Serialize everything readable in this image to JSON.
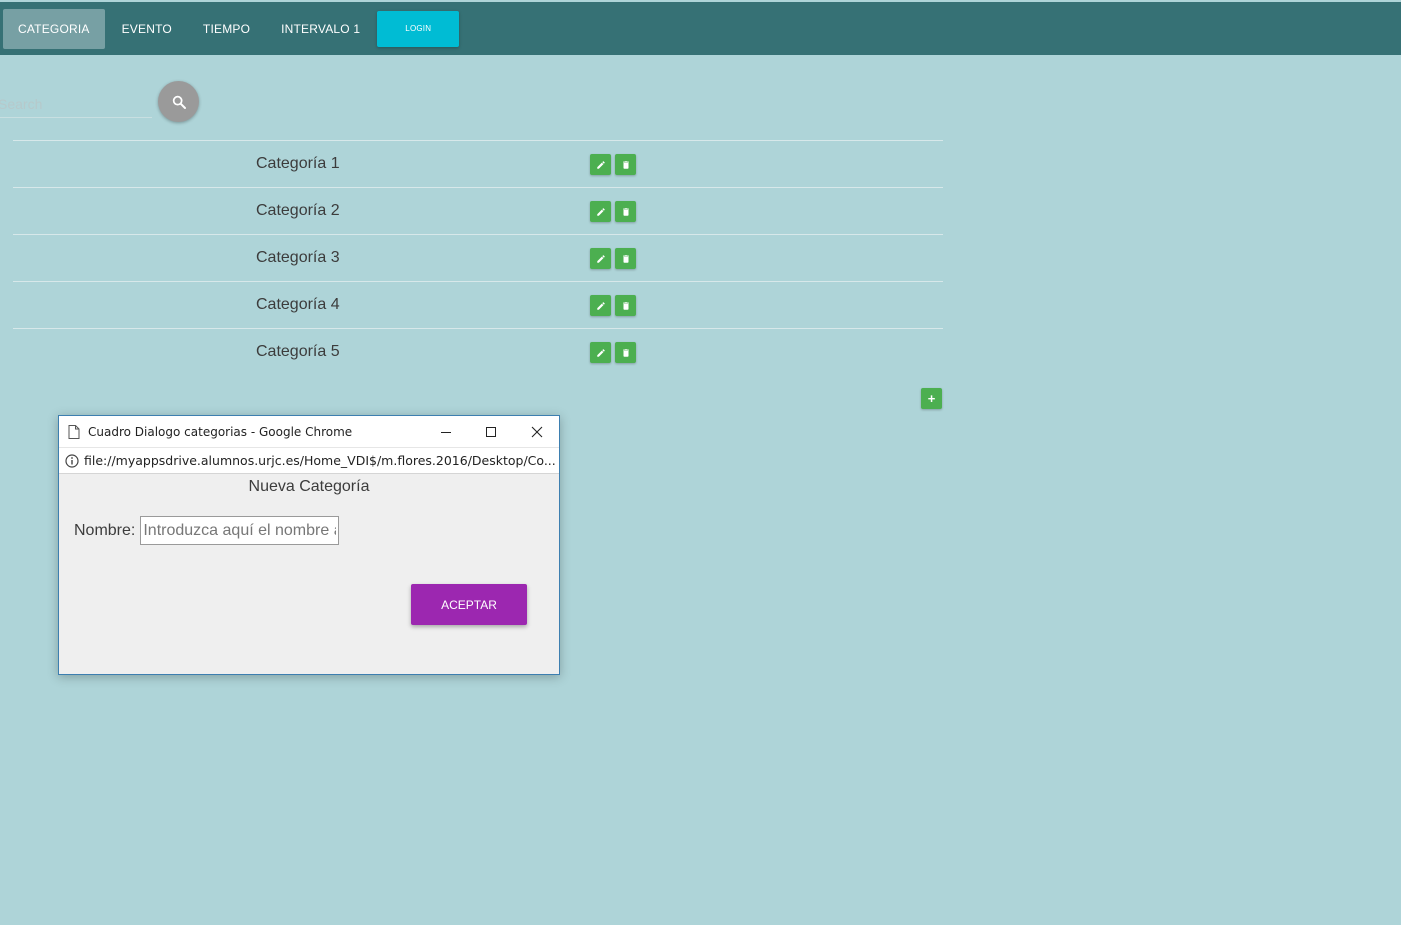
{
  "navbar": {
    "items": [
      {
        "label": "CATEGORIA",
        "active": true
      },
      {
        "label": "EVENTO"
      },
      {
        "label": "TIEMPO"
      },
      {
        "label": "INTERVALO 1"
      }
    ],
    "login_label": "LOGIN"
  },
  "search": {
    "placeholder": "Search",
    "icon": "search-icon"
  },
  "table": {
    "rows": [
      {
        "name": "Categoría 1"
      },
      {
        "name": "Categoría 2"
      },
      {
        "name": "Categoría 3"
      },
      {
        "name": "Categoría 4"
      },
      {
        "name": "Categoría 5"
      }
    ],
    "add_label": "+"
  },
  "dialog": {
    "window_title": "Cuadro Dialogo categorias - Google Chrome",
    "url": "file://myappsdrive.alumnos.urjc.es/Home_VDI$/m.flores.2016/Desktop/Co...",
    "heading": "Nueva Categoría",
    "nombre_label": "Nombre:",
    "nombre_placeholder": "Introduzca aquí el nombre a",
    "accept_label": "ACEPTAR"
  },
  "colors": {
    "page_bg": "#aed4d8",
    "navbar_bg": "#367175",
    "login_bg": "#00bcd4",
    "action_green": "#4caf50",
    "accept_purple": "#9c27b0"
  }
}
